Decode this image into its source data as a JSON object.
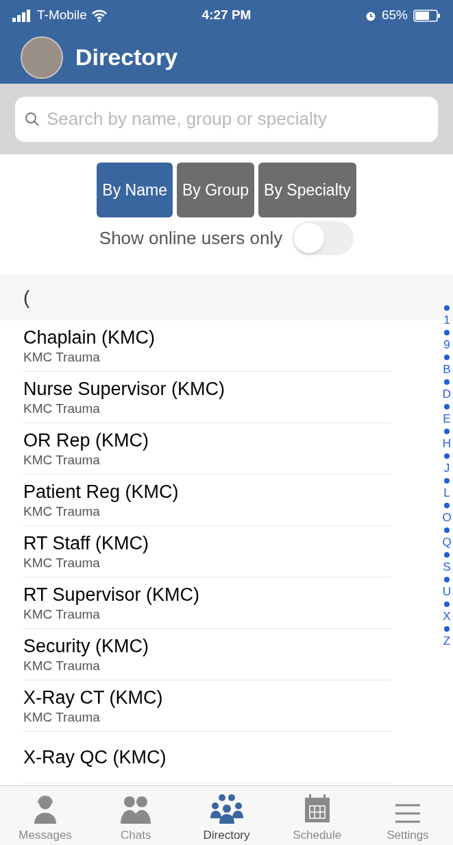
{
  "status_bar": {
    "carrier": "T-Mobile",
    "time": "4:27 PM",
    "battery": "65%"
  },
  "header": {
    "title": "Directory"
  },
  "search": {
    "placeholder": "Search by name, group or specialty"
  },
  "segments": [
    {
      "label": "By Name",
      "selected": true
    },
    {
      "label": "By Group",
      "selected": false
    },
    {
      "label": "By Specialty",
      "selected": false
    }
  ],
  "online_filter": {
    "label": "Show online users only",
    "on": false
  },
  "section_header": "(",
  "contacts": [
    {
      "name": "Chaplain (KMC)",
      "group": "KMC Trauma"
    },
    {
      "name": "Nurse Supervisor (KMC)",
      "group": "KMC Trauma"
    },
    {
      "name": "OR Rep (KMC)",
      "group": "KMC Trauma"
    },
    {
      "name": "Patient Reg (KMC)",
      "group": "KMC Trauma"
    },
    {
      "name": "RT Staff (KMC)",
      "group": "KMC Trauma"
    },
    {
      "name": "RT Supervisor (KMC)",
      "group": "KMC Trauma"
    },
    {
      "name": "Security (KMC)",
      "group": "KMC Trauma"
    },
    {
      "name": "X-Ray CT (KMC)",
      "group": "KMC Trauma"
    },
    {
      "name": "X-Ray QC (KMC)"
    }
  ],
  "index": [
    "1",
    "9",
    "B",
    "D",
    "E",
    "H",
    "J",
    "L",
    "O",
    "Q",
    "S",
    "U",
    "X",
    "Z"
  ],
  "tab_bar": [
    {
      "kind": "messages",
      "label": "Messages",
      "selected": false
    },
    {
      "kind": "chats",
      "label": "Chats",
      "selected": false
    },
    {
      "kind": "directory",
      "label": "Directory",
      "selected": true
    },
    {
      "kind": "schedule",
      "label": "Schedule",
      "selected": false
    },
    {
      "kind": "settings",
      "label": "Settings",
      "selected": false
    }
  ]
}
